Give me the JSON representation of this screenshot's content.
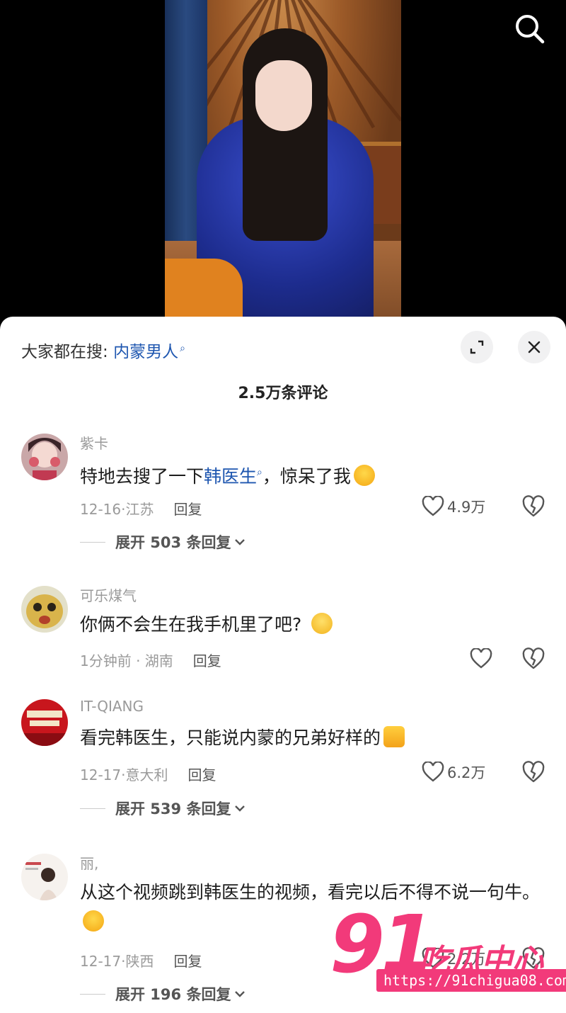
{
  "panel": {
    "hot_search_prefix": "大家都在搜:",
    "hot_search_keyword": "内蒙男人",
    "comment_count": "2.5万条评论"
  },
  "comments": [
    {
      "user": "紫卡",
      "text_before": "特地去搜了一下",
      "keyword": "韩医生",
      "text_after": "，惊呆了我",
      "emoji": "crying-laugh-emoji",
      "date_loc": "12-16·江苏",
      "reply": "回复",
      "likes": "4.9万",
      "expand": "展开 503 条回复"
    },
    {
      "user": "可乐煤气",
      "text": "你俩不会生在我手机里了吧?",
      "emoji": "pleading-emoji",
      "date_loc": "1分钟前 · 湖南",
      "reply": "回复",
      "likes": ""
    },
    {
      "user": "IT-QIANG",
      "text": "看完韩医生，只能说内蒙的兄弟好样的",
      "emoji": "thumbs-up-emoji",
      "date_loc": "12-17·意大利",
      "reply": "回复",
      "likes": "6.2万",
      "expand": "展开 539 条回复"
    },
    {
      "user": "丽,",
      "text": "从这个视频跳到韩医生的视频，看完以后不得不说一句牛。",
      "emoji": "crying-laugh-emoji",
      "date_loc": "12-17·陕西",
      "reply": "回复",
      "likes": "2.2万",
      "expand": "展开 196 条回复"
    }
  ],
  "watermark": {
    "number": "91",
    "name": "吃瓜中心",
    "url": "https://91chigua08.com"
  },
  "colors": {
    "link_blue": "#1f57b0",
    "watermark_pink": "#f23a7a",
    "muted_text": "#9a9a9a"
  }
}
